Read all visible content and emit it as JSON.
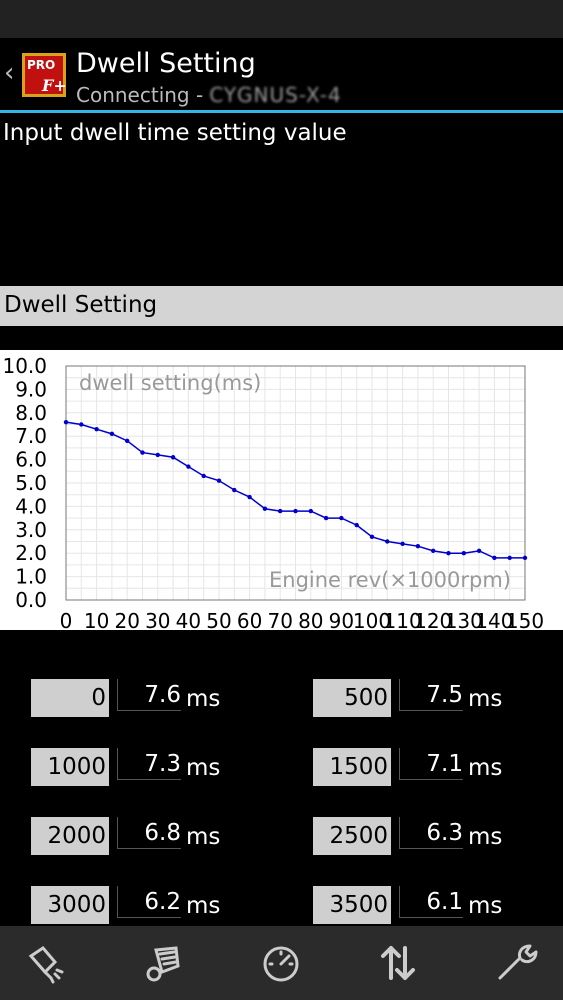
{
  "app": {
    "title": "Dwell Setting",
    "subtitle_prefix": "Connecting -",
    "device_name": "CYGNUS-X-4",
    "logo_text_top": "PRO",
    "logo_text_bottom": "F+"
  },
  "instruction": "Input dwell time setting value",
  "section_header": "Dwell Setting",
  "colors": {
    "accent": "#33b5e5",
    "series": "#0000cc",
    "header_bg": "#d4d4d4"
  },
  "chart_data": {
    "type": "line",
    "title": "dwell setting(ms)",
    "xlabel": "Engine rev(×1000rpm)",
    "ylabel": "",
    "ylim": [
      0,
      10
    ],
    "xlim": [
      0,
      15
    ],
    "y_ticks": [
      "0.0",
      "1.0",
      "2.0",
      "3.0",
      "4.0",
      "5.0",
      "6.0",
      "7.0",
      "8.0",
      "9.0",
      "10.0"
    ],
    "x_ticks": [
      "0",
      "10",
      "20",
      "30",
      "40",
      "50",
      "60",
      "70",
      "80",
      "90",
      "100",
      "110",
      "120",
      "130",
      "140",
      "150"
    ],
    "grid": true,
    "series": [
      {
        "x": [
          0,
          0.5,
          1,
          1.5,
          2,
          2.5,
          3,
          3.5,
          4,
          4.5,
          5,
          5.5,
          6,
          6.5,
          7,
          7.5,
          8,
          8.5,
          9,
          9.5,
          10,
          10.5,
          11,
          11.5,
          12,
          12.5,
          13,
          13.5,
          14,
          14.5,
          15
        ],
        "values": [
          7.6,
          7.5,
          7.3,
          7.1,
          6.8,
          6.3,
          6.2,
          6.1,
          5.7,
          5.3,
          5.1,
          4.7,
          4.4,
          3.9,
          3.8,
          3.8,
          3.8,
          3.5,
          3.5,
          3.2,
          2.7,
          2.5,
          2.4,
          2.3,
          2.1,
          2.0,
          2.0,
          2.1,
          1.8,
          1.8,
          1.8
        ]
      }
    ]
  },
  "unit": "ms",
  "rows": [
    {
      "rpm": "0",
      "value": "7.6"
    },
    {
      "rpm": "500",
      "value": "7.5"
    },
    {
      "rpm": "1000",
      "value": "7.3"
    },
    {
      "rpm": "1500",
      "value": "7.1"
    },
    {
      "rpm": "2000",
      "value": "6.8"
    },
    {
      "rpm": "2500",
      "value": "6.3"
    },
    {
      "rpm": "3000",
      "value": "6.2"
    },
    {
      "rpm": "3500",
      "value": "6.1"
    }
  ],
  "bottom_nav": [
    {
      "icon": "ignition-icon"
    },
    {
      "icon": "engine-settings-icon"
    },
    {
      "icon": "gauge-icon"
    },
    {
      "icon": "transfer-icon"
    },
    {
      "icon": "wrench-icon"
    }
  ]
}
